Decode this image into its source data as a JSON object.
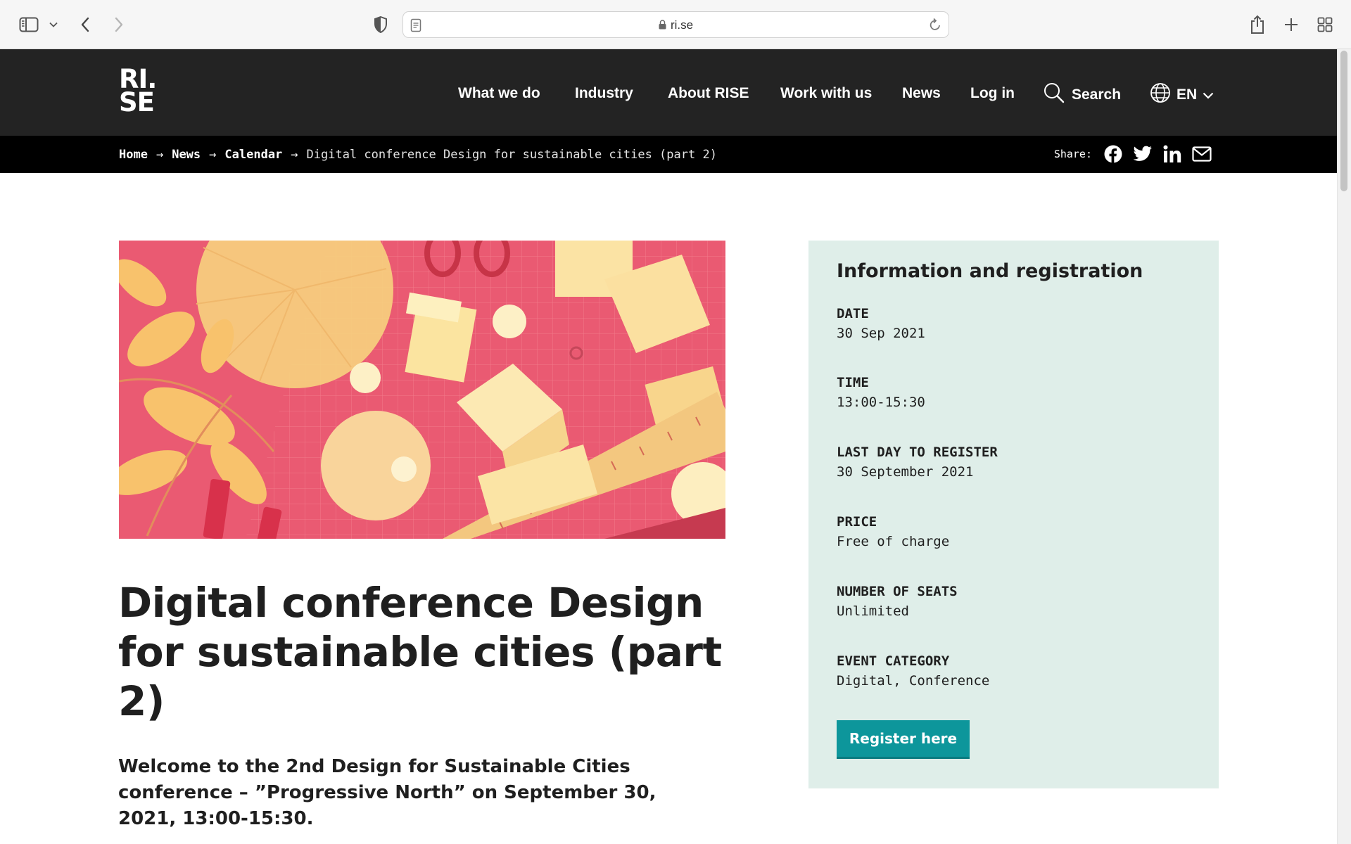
{
  "browser": {
    "url": "ri.se"
  },
  "site": {
    "logo_line1": "RI.",
    "logo_line2": "SE",
    "nav": {
      "items": [
        "What we do",
        "Industry",
        "About RISE",
        "Work with us",
        "News",
        "Log in"
      ],
      "search_label": "Search",
      "language": "EN"
    }
  },
  "breadcrumb": {
    "items": [
      "Home",
      "News",
      "Calendar"
    ],
    "separator": "→",
    "current": "Digital conference Design for sustainable cities (part 2)"
  },
  "share": {
    "label": "Share:",
    "icons": [
      "facebook-icon",
      "twitter-icon",
      "linkedin-icon",
      "mail-icon"
    ]
  },
  "article": {
    "title": "Digital conference Design for sustainable cities (part 2)",
    "lead": "Welcome to the 2nd Design for Sustainable Cities conference – ”Progressive North” on September 30, 2021, 13:00-15:30."
  },
  "info": {
    "heading": "Information and registration",
    "rows": [
      {
        "label": "DATE",
        "value": "30 Sep 2021"
      },
      {
        "label": "TIME",
        "value": "13:00-15:30"
      },
      {
        "label": "LAST DAY TO REGISTER",
        "value": "30 September 2021"
      },
      {
        "label": "PRICE",
        "value": "Free of charge"
      },
      {
        "label": "NUMBER OF SEATS",
        "value": "Unlimited"
      },
      {
        "label": "EVENT CATEGORY",
        "value": "Digital, Conference"
      }
    ],
    "register_label": "Register here"
  },
  "colors": {
    "header_bg": "#232323",
    "breadcrumb_bg": "#000000",
    "info_panel_bg": "#dfeee9",
    "register_button": "#0d969b",
    "hero_red": "#ea5a72",
    "hero_yellow": "#f9de8d"
  }
}
